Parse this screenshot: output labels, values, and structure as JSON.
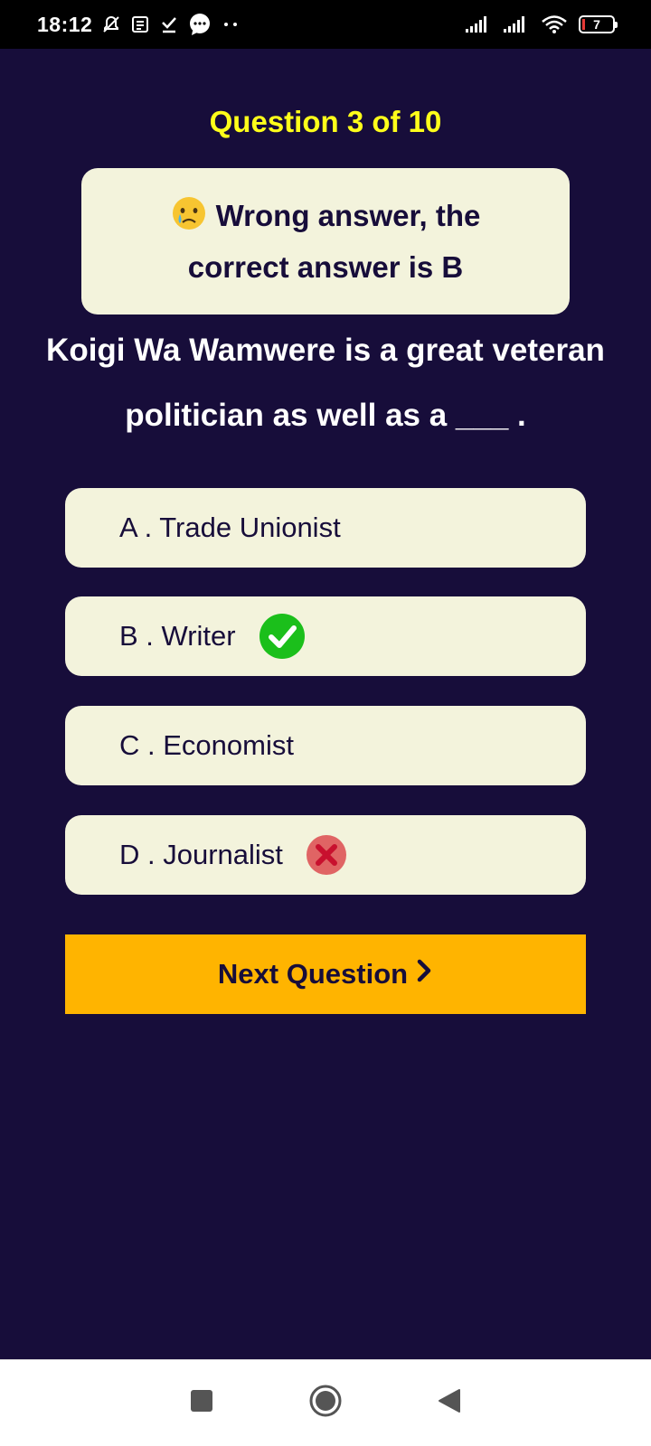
{
  "status_bar": {
    "time": "18:12",
    "battery_level": "7",
    "icons": [
      "notifications-off-icon",
      "news-icon",
      "download-done-icon",
      "chat-bubble-icon",
      "more-dots-icon",
      "signal-icon",
      "signal-icon",
      "wifi-icon",
      "battery-icon"
    ]
  },
  "quiz": {
    "counter": "Question 3 of 10",
    "feedback_emoji": "crying-face-icon",
    "feedback_text": "Wrong answer, the correct answer is B",
    "question": "Koigi Wa Wamwere is a great veteran politician as well as a ___ .",
    "options": [
      {
        "label": "A . Trade Unionist",
        "state": "none"
      },
      {
        "label": "B . Writer",
        "state": "correct"
      },
      {
        "label": "C . Economist",
        "state": "none"
      },
      {
        "label": "D . Journalist",
        "state": "wrong"
      }
    ],
    "next_label": "Next Question",
    "next_icon": "chevron-right-icon"
  },
  "colors": {
    "background": "#170d3a",
    "card": "#f3f3dc",
    "counter": "#ffff1a",
    "accent": "#ffb400",
    "correct": "#1bbf1b",
    "wrong": "#e06464"
  },
  "nav_bar": {
    "icons": [
      "recents-square-icon",
      "home-circle-icon",
      "back-triangle-icon"
    ]
  }
}
